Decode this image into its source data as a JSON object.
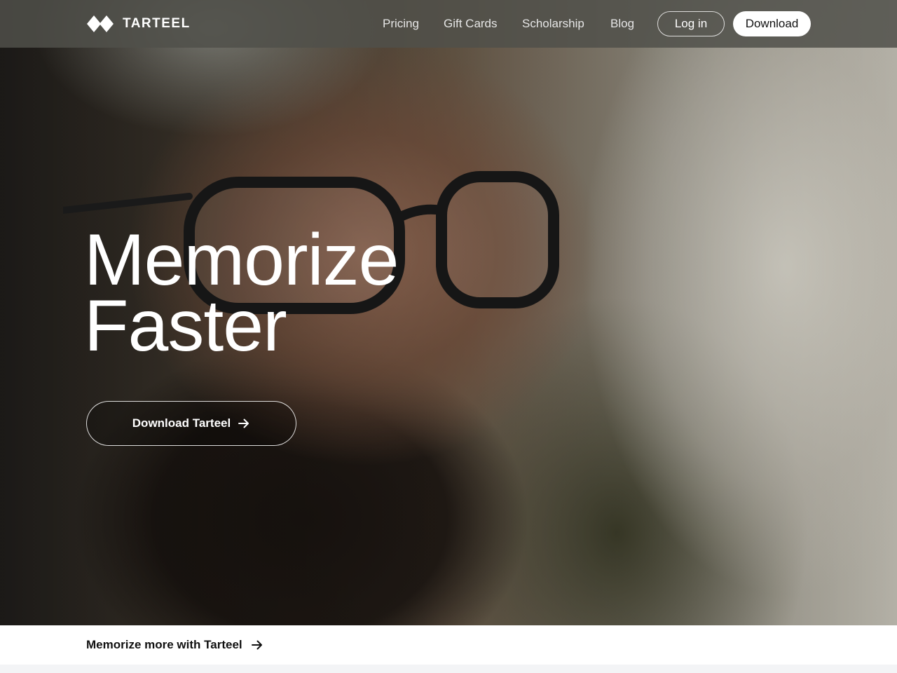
{
  "brand": {
    "name": "TARTEEL",
    "logo_icon": "tarteel-diamond-logo-icon"
  },
  "nav": {
    "links": [
      "Pricing",
      "Gift Cards",
      "Scholarship",
      "Blog"
    ],
    "login_label": "Log in",
    "download_label": "Download"
  },
  "hero": {
    "headline_line1": "Memorize",
    "headline_line2": "Faster",
    "cta_label": "Download Tarteel",
    "cta_icon": "arrow-right-icon"
  },
  "footer_bar": {
    "link_label": "Memorize more with Tarteel",
    "link_icon": "arrow-right-icon"
  },
  "colors": {
    "accent": "#ffffff",
    "text_dark": "#111111",
    "nav_bg": "#50504a"
  }
}
